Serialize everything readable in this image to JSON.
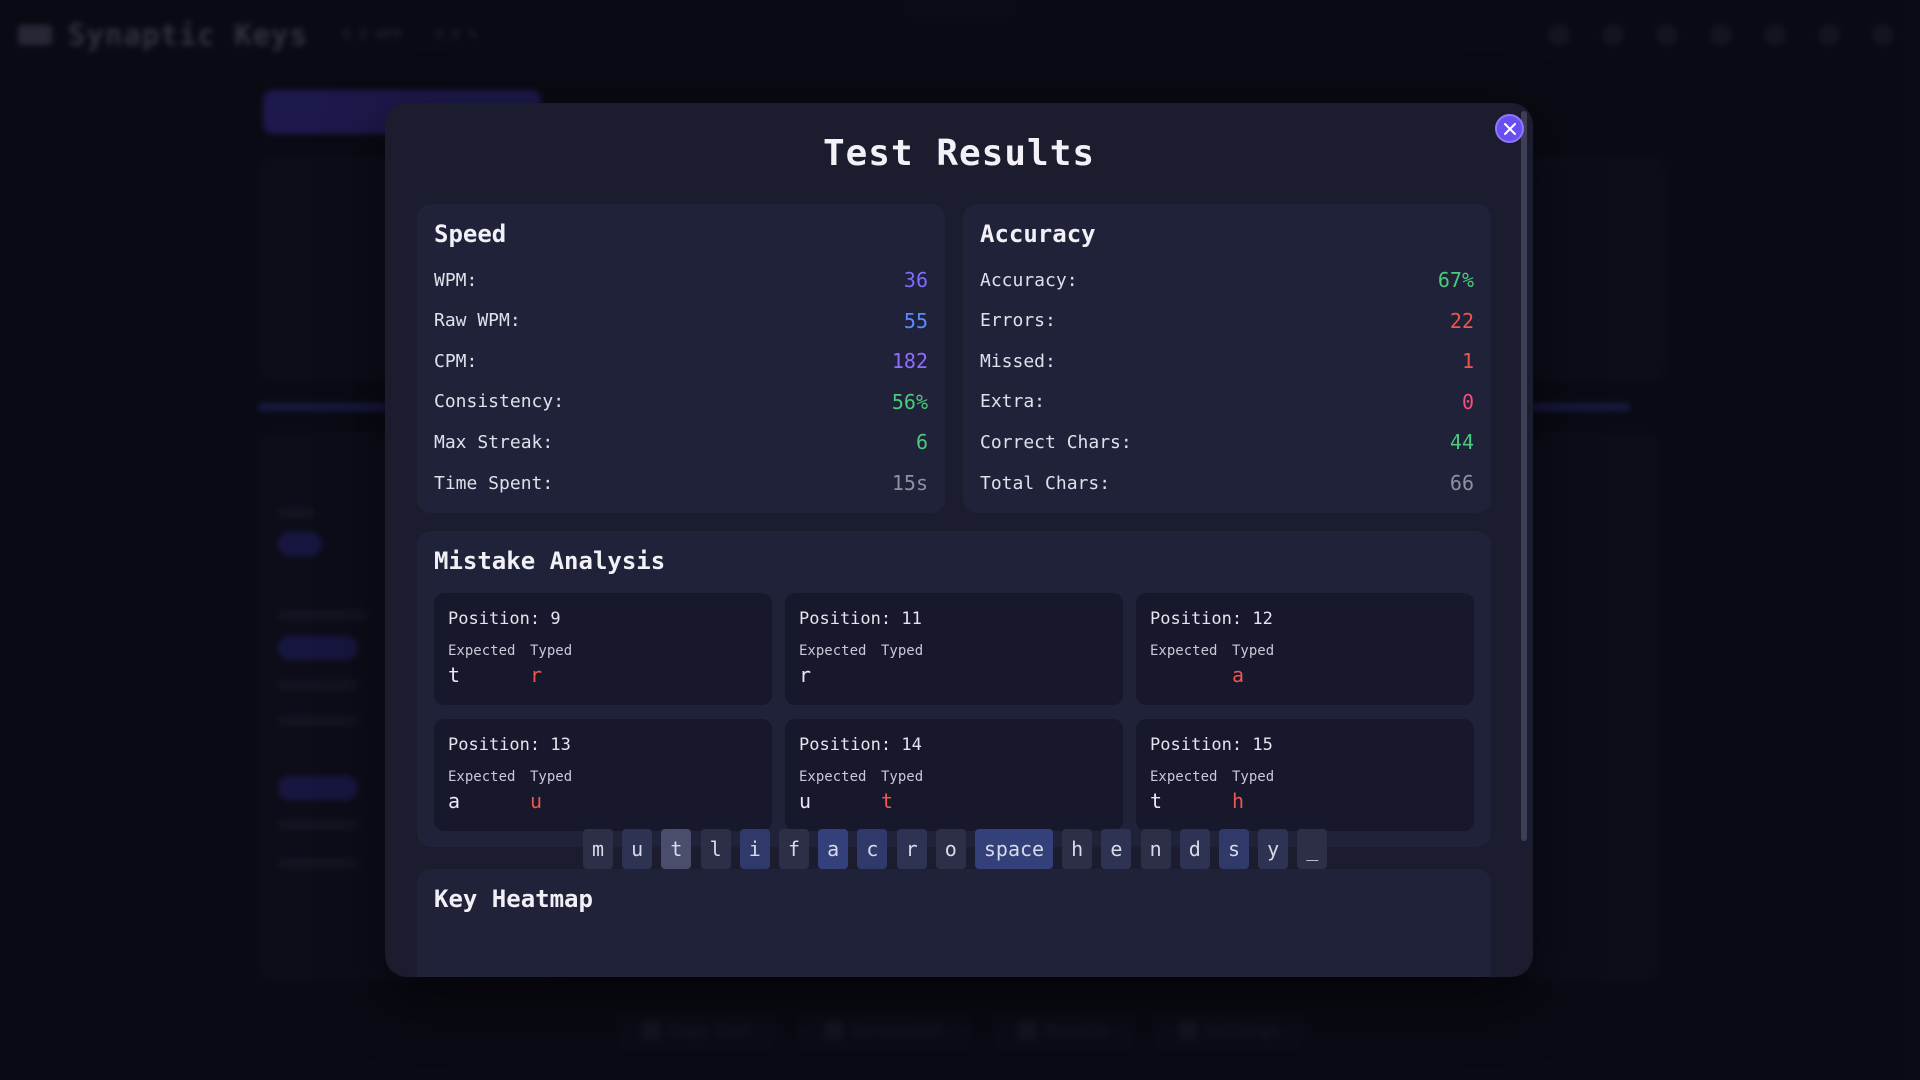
{
  "background": {
    "app_title": "Synaptic Keys",
    "top_chip_1": "0.0 WPM",
    "top_chip_2": "0.0 %",
    "bottom_buttons": [
      "Copy Text",
      "Screenshot",
      "Results",
      "Settings"
    ]
  },
  "modal": {
    "title": "Test Results",
    "close_symbol": "✕",
    "speed": {
      "title": "Speed",
      "rows": [
        {
          "label": "WPM:",
          "value": "36",
          "color": "#7c6cff"
        },
        {
          "label": "Raw WPM:",
          "value": "55",
          "color": "#5b8cff"
        },
        {
          "label": "CPM:",
          "value": "182",
          "color": "#8f6cff"
        },
        {
          "label": "Consistency:",
          "value": "56%",
          "color": "#4cc97a"
        },
        {
          "label": "Max Streak:",
          "value": "6",
          "color": "#4cc97a"
        },
        {
          "label": "Time Spent:",
          "value": "15s",
          "color": "#8e90a4"
        }
      ]
    },
    "accuracy": {
      "title": "Accuracy",
      "rows": [
        {
          "label": "Accuracy:",
          "value": "67%",
          "color": "#4cc97a"
        },
        {
          "label": "Errors:",
          "value": "22",
          "color": "#f0554f"
        },
        {
          "label": "Missed:",
          "value": "1",
          "color": "#f0554f"
        },
        {
          "label": "Extra:",
          "value": "0",
          "color": "#f04f7a"
        },
        {
          "label": "Correct Chars:",
          "value": "44",
          "color": "#4cc97a"
        },
        {
          "label": "Total Chars:",
          "value": "66",
          "color": "#8e90a4"
        }
      ]
    },
    "mistakes": {
      "title": "Mistake Analysis",
      "expected_label": "Expected",
      "typed_label": "Typed",
      "items": [
        {
          "position": "Position: 9",
          "expected": "t",
          "typed": "r"
        },
        {
          "position": "Position: 11",
          "expected": "r",
          "typed": ""
        },
        {
          "position": "Position: 12",
          "expected": "",
          "typed": "a"
        },
        {
          "position": "Position: 13",
          "expected": "a",
          "typed": "u"
        },
        {
          "position": "Position: 14",
          "expected": "u",
          "typed": "t"
        },
        {
          "position": "Position: 15",
          "expected": "t",
          "typed": "h"
        }
      ]
    },
    "heatmap": {
      "title": "Key Heatmap",
      "keys": [
        {
          "key": "m",
          "color": "#2d2f48"
        },
        {
          "key": "u",
          "color": "#2e3354"
        },
        {
          "key": "t",
          "color": "#4a4d6c"
        },
        {
          "key": "l",
          "color": "#2d2f48"
        },
        {
          "key": "i",
          "color": "#2f3a6a"
        },
        {
          "key": "f",
          "color": "#2d2f48"
        },
        {
          "key": "a",
          "color": "#34407a"
        },
        {
          "key": "c",
          "color": "#2f3a6a"
        },
        {
          "key": "r",
          "color": "#2e3354"
        },
        {
          "key": "o",
          "color": "#2d2f48"
        },
        {
          "key": "space",
          "color": "#34407a"
        },
        {
          "key": "h",
          "color": "#2d2f48"
        },
        {
          "key": "e",
          "color": "#2e3354"
        },
        {
          "key": "n",
          "color": "#2d2f48"
        },
        {
          "key": "d",
          "color": "#2e3354"
        },
        {
          "key": "s",
          "color": "#2f3a6a"
        },
        {
          "key": "y",
          "color": "#2e3354"
        },
        {
          "key": "_",
          "color": "#2d2f48"
        }
      ]
    }
  }
}
